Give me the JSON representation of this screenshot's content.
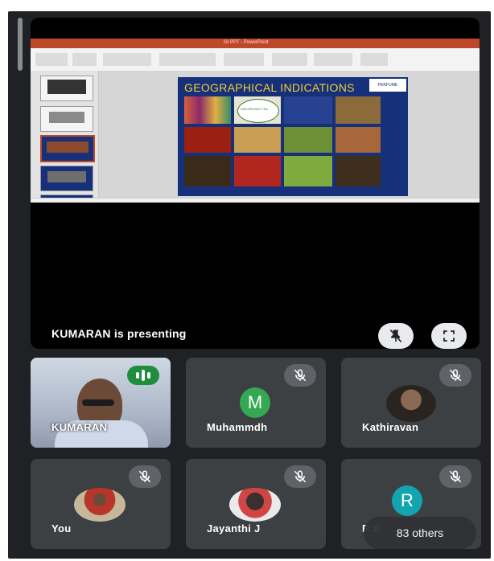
{
  "slide_window": {
    "app_title": "GI PPT - PowerPoint",
    "slide_title": "GEOGRAPHICAL INDICATIONS",
    "logo_text": "PERFUME",
    "badge_text": "DARJEELING TEA"
  },
  "stage": {
    "presenting_text": "KUMARAN is presenting",
    "unpin_icon": "pin-off-icon",
    "fullscreen_icon": "fullscreen-icon"
  },
  "participants": [
    {
      "name": "KUMARAN",
      "status": "speaking",
      "avatar": "photo"
    },
    {
      "name": "Muhammdh",
      "status": "muted",
      "avatar_letter": "M",
      "avatar_color": "#34a853"
    },
    {
      "name": "Kathiravan",
      "status": "muted",
      "avatar": "photo"
    },
    {
      "name": "You",
      "status": "muted",
      "avatar": "photo"
    },
    {
      "name": "Jayanthi J",
      "status": "muted",
      "avatar": "photo"
    },
    {
      "name": "R.E",
      "status": "muted",
      "avatar_letter": "R",
      "avatar_color": "#12a4af"
    }
  ],
  "others_label": "83 others",
  "colors": {
    "background": "#202124",
    "tile": "#3c4043",
    "speaking_green": "#1e8e3e",
    "mute_badge": "#5f6368"
  }
}
